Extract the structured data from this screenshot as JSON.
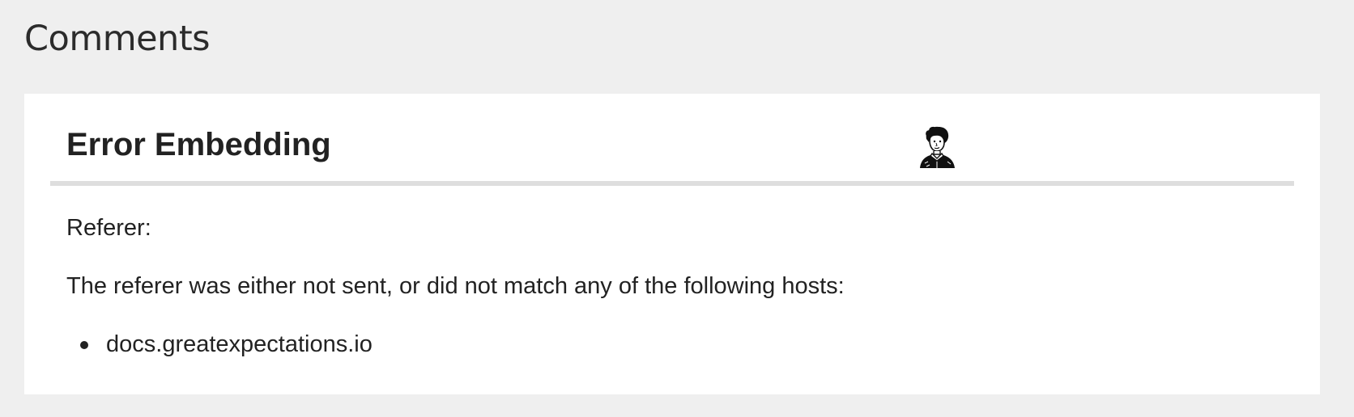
{
  "section": {
    "title": "Comments"
  },
  "embed_error": {
    "title": "Error Embedding",
    "mascot_icon": "portrait-illustration-icon",
    "referer_label": "Referer:",
    "message": "The referer was either not sent, or did not match any of the following hosts:",
    "hosts": [
      "docs.greatexpectations.io"
    ]
  },
  "colors": {
    "page_background": "#efefef",
    "card_background": "#ffffff",
    "divider": "#dedede",
    "text": "#222222"
  }
}
